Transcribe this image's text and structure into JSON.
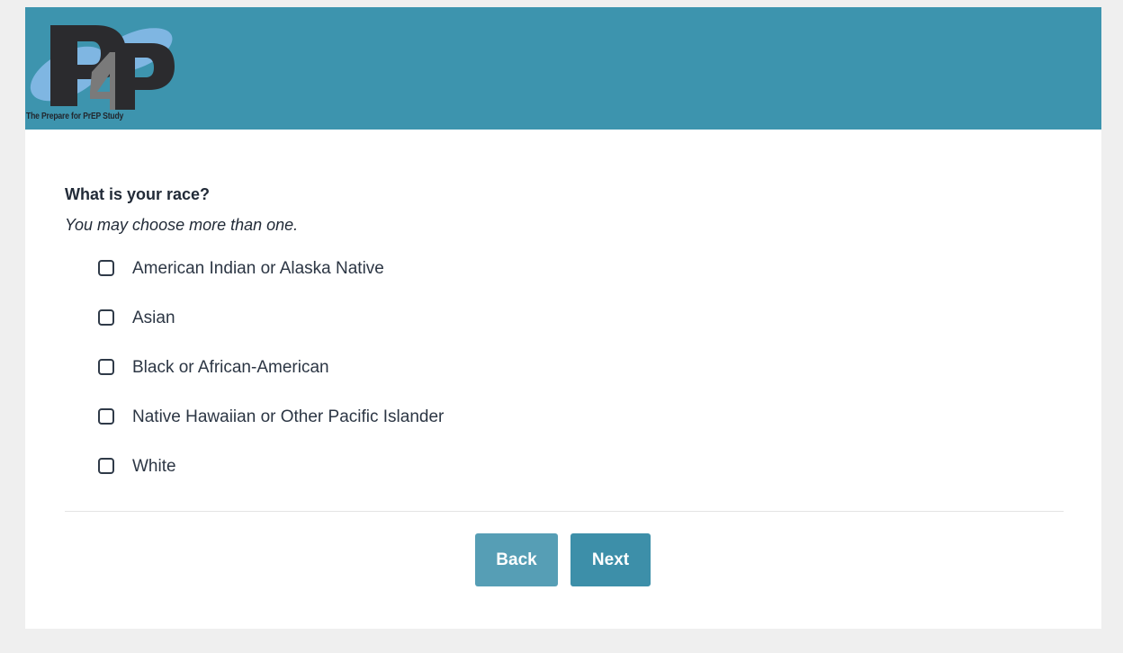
{
  "header": {
    "logo_text": "P4P",
    "logo_caption": "The Prepare for PrEP Study",
    "background_color": "#3d94ae"
  },
  "question": {
    "title": "What is your race?",
    "hint": "You may choose more than one."
  },
  "options": [
    {
      "label": "American Indian or Alaska Native",
      "checked": false
    },
    {
      "label": "Asian",
      "checked": false
    },
    {
      "label": "Black or African-American",
      "checked": false
    },
    {
      "label": "Native Hawaiian or Other Pacific Islander",
      "checked": false
    },
    {
      "label": "White",
      "checked": false
    }
  ],
  "buttons": {
    "back_label": "Back",
    "next_label": "Next",
    "back_color": "#569eb5",
    "next_color": "#3d8fa9"
  }
}
